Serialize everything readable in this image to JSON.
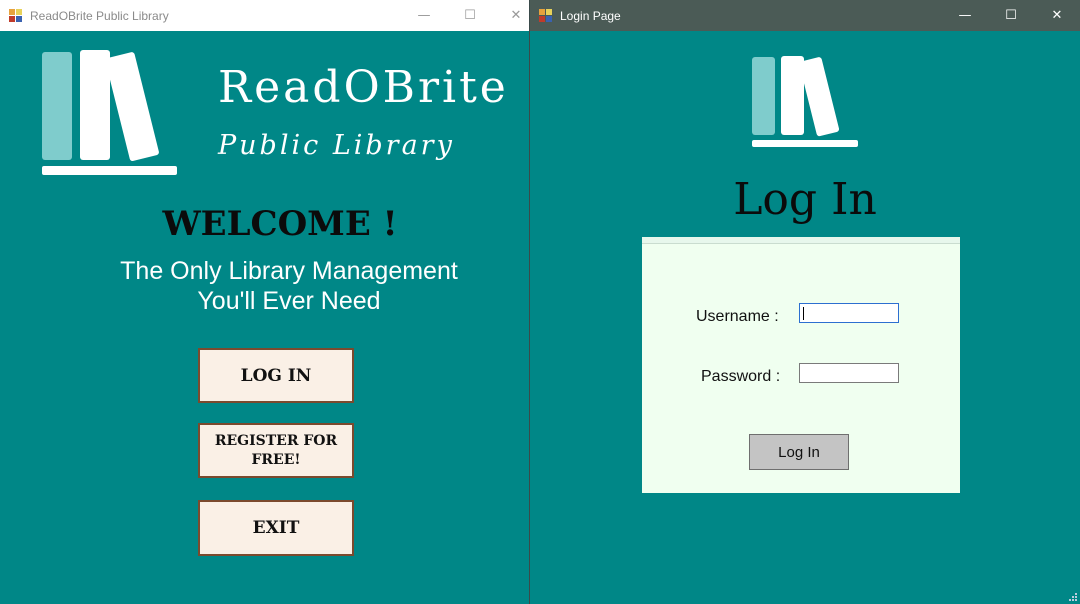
{
  "main_window": {
    "title": "ReadOBrite Public Library",
    "brand_name": "ReadOBrite",
    "brand_subtitle": "Public Library",
    "welcome": "WELCOME !",
    "tagline_line1": "The Only Library Management",
    "tagline_line2": "You'll Ever Need",
    "buttons": {
      "login": "LOG IN",
      "register": "REGISTER FOR FREE!",
      "exit": "EXIT"
    }
  },
  "login_window": {
    "title": "Login Page",
    "heading": "Log In",
    "username_label": "Username :",
    "password_label": "Password :",
    "username_value": "",
    "password_value": "",
    "submit_label": "Log In"
  },
  "window_controls": {
    "minimize": "—",
    "maximize": "☐",
    "close": "✕"
  },
  "colors": {
    "background_teal": "#008787",
    "book_accent": "#7fcccc",
    "button_face": "#faf0e6",
    "button_border": "#7b4a2e",
    "panel_bg": "#f0fff0"
  },
  "icons": [
    "app-icon",
    "library-logo-icon",
    "minimize-icon",
    "maximize-icon",
    "close-icon",
    "resize-grip-icon"
  ]
}
